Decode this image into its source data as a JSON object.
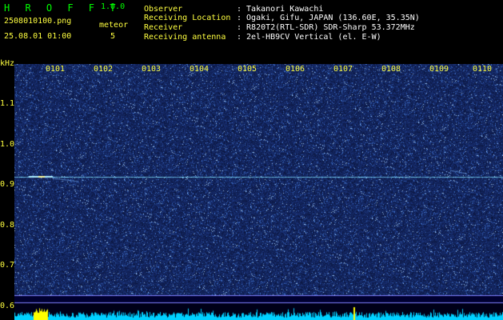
{
  "app": {
    "title": "H R O F F T",
    "version": "1.0.0"
  },
  "file": {
    "name": "2508010100.png",
    "datetime": "25.08.01 01:00"
  },
  "meteor": {
    "label": "meteor",
    "count": "5"
  },
  "info": {
    "observer_label": "Observer",
    "observer_value": ": Takanori Kawachi",
    "location_label": "Receiving Location",
    "location_value": ": Ogaki, Gifu, JAPAN (136.60E, 35.35N)",
    "receiver_label": "Receiver",
    "receiver_value": ": R820T2(RTL-SDR) SDR-Sharp 53.372MHz",
    "antenna_label": "Receiving antenna",
    "antenna_value": ": 2el-HB9CV Vertical (el. E-W)"
  },
  "spectrogram": {
    "unit_label": "kHz",
    "time_ticks": [
      "0101",
      "0102",
      "0103",
      "0104",
      "0105",
      "0106",
      "0107",
      "0108",
      "0109",
      "0110"
    ],
    "freq_ticks": [
      "1.1",
      "1.0",
      "0.9",
      "0.8",
      "0.7",
      "0.6"
    ],
    "colors": {
      "background": "#0a0a40",
      "noise": "#3040c0",
      "carrier": "#80e0ff",
      "spectrum": "#00d0ff",
      "burst": "#ffff00"
    }
  }
}
